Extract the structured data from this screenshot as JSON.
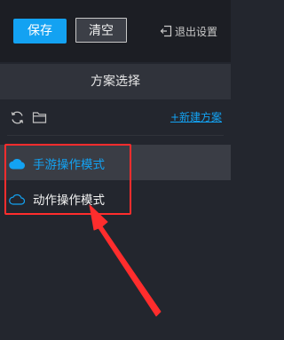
{
  "toolbar": {
    "save_label": "保存",
    "clear_label": "清空",
    "exit_label": "退出设置"
  },
  "section": {
    "title": "方案选择"
  },
  "tools": {
    "new_scheme_label": "+新建方案"
  },
  "schemes": {
    "items": [
      {
        "label": "手游操作模式",
        "selected": true
      },
      {
        "label": "动作操作模式",
        "selected": false
      }
    ]
  },
  "colors": {
    "accent": "#13a2f2",
    "background": "#23262e",
    "annotation": "#ff2d2d"
  },
  "icons": {
    "exit": "exit-icon",
    "refresh": "refresh-icon",
    "folder": "folder-icon",
    "cloud": "cloud-icon",
    "arrow": "annotation-arrow"
  }
}
